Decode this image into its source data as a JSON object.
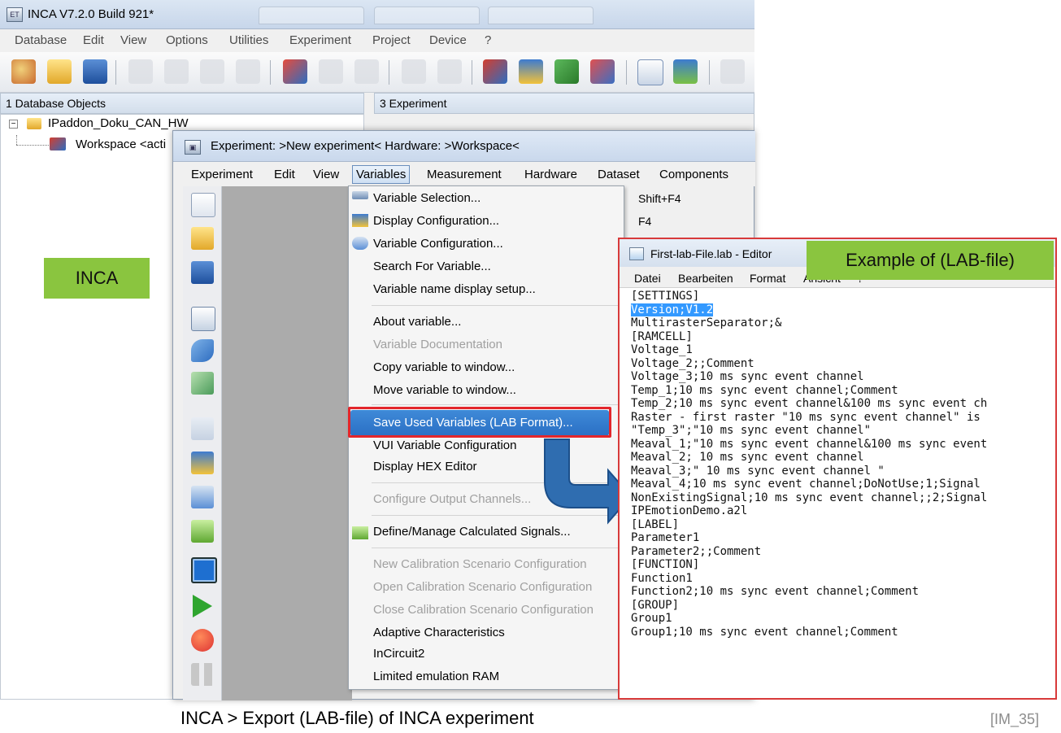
{
  "main_window": {
    "title": "INCA V7.2.0 Build 921*",
    "menu": [
      "Database",
      "Edit",
      "View",
      "Options",
      "Utilities",
      "Experiment",
      "Project",
      "Device",
      "?"
    ],
    "db_pane_title": "1 Database Objects",
    "exp_pane_title": "3 Experiment",
    "tree": {
      "root": "IPaddon_Doku_CAN_HW",
      "child": "Workspace <acti"
    }
  },
  "inca_label": "INCA",
  "experiment_window": {
    "title": "Experiment: >New experiment< Hardware: >Workspace<",
    "menu": [
      "Experiment",
      "Edit",
      "View",
      "Variables",
      "Measurement",
      "Hardware",
      "Dataset",
      "Components"
    ],
    "active_menu": "Variables"
  },
  "variables_menu": {
    "items": [
      {
        "label": "Variable Selection...",
        "shortcut": "Shift+F4",
        "enabled": true,
        "icon": "variable-selection-icon"
      },
      {
        "label": "Display Configuration...",
        "shortcut": "F4",
        "enabled": true,
        "icon": "display-config-icon"
      },
      {
        "label": "Variable Configuration...",
        "shortcut": "",
        "enabled": true,
        "icon": "variable-config-icon"
      },
      {
        "label": "Search For Variable...",
        "shortcut": "",
        "enabled": true,
        "icon": ""
      },
      {
        "label": "Variable name display setup...",
        "shortcut": "",
        "enabled": true,
        "icon": ""
      },
      {
        "label": "About variable...",
        "shortcut": "",
        "enabled": true,
        "icon": ""
      },
      {
        "label": "Variable Documentation",
        "shortcut": "",
        "enabled": false,
        "icon": ""
      },
      {
        "label": "Copy variable to window...",
        "shortcut": "",
        "enabled": true,
        "icon": ""
      },
      {
        "label": "Move variable to window...",
        "shortcut": "",
        "enabled": true,
        "icon": ""
      },
      {
        "label": "Save Used Variables (LAB Format)...",
        "shortcut": "",
        "enabled": true,
        "icon": "",
        "highlighted": true
      },
      {
        "label": "VUI Variable Configuration",
        "shortcut": "",
        "enabled": true,
        "icon": ""
      },
      {
        "label": "Display HEX Editor",
        "shortcut": "",
        "enabled": true,
        "icon": ""
      },
      {
        "label": "Configure Output Channels...",
        "shortcut": "",
        "enabled": false,
        "icon": ""
      },
      {
        "label": "Define/Manage Calculated Signals...",
        "shortcut": "",
        "enabled": true,
        "icon": "calculated-signals-icon"
      },
      {
        "label": "New Calibration Scenario Configuration",
        "shortcut": "",
        "enabled": false,
        "icon": ""
      },
      {
        "label": "Open Calibration Scenario Configuration",
        "shortcut": "",
        "enabled": false,
        "icon": ""
      },
      {
        "label": "Close Calibration Scenario Configuration",
        "shortcut": "",
        "enabled": false,
        "icon": ""
      },
      {
        "label": "Adaptive Characteristics",
        "shortcut": "",
        "enabled": true,
        "icon": ""
      },
      {
        "label": "InCircuit2",
        "shortcut": "",
        "enabled": true,
        "icon": ""
      },
      {
        "label": "Limited emulation RAM",
        "shortcut": "",
        "enabled": true,
        "icon": ""
      }
    ]
  },
  "editor": {
    "title": "First-lab-File.lab - Editor",
    "menu": [
      "Datei",
      "Bearbeiten",
      "Format",
      "Ansicht",
      "?"
    ],
    "selected_line": "Version;V1.2",
    "lines": [
      "[SETTINGS]",
      "Version;V1.2",
      "MultirasterSeparator;&",
      "[RAMCELL]",
      "Voltage_1",
      "Voltage_2;;Comment",
      "Voltage_3;10 ms sync event channel",
      "Temp_1;10 ms sync event channel;Comment",
      "Temp_2;10 ms sync event channel&100 ms sync event ch",
      "Raster - first raster \"10 ms sync event channel\" is",
      "\"Temp_3\";\"10 ms sync event channel\"",
      "Meaval_1;\"10 ms sync event channel&100 ms sync event",
      "Meaval_2; 10 ms sync event channel",
      "Meaval_3;\" 10 ms sync event channel \"",
      "Meaval_4;10 ms sync event channel;DoNotUse;1;Signal",
      "NonExistingSignal;10 ms sync event channel;;2;Signal",
      "IPEmotionDemo.a2l",
      "[LABEL]",
      "Parameter1",
      "Parameter2;;Comment",
      "[FUNCTION]",
      "Function1",
      "Function2;10 ms sync event channel;Comment",
      "[GROUP]",
      "Group1",
      "Group1;10 ms sync event channel;Comment"
    ]
  },
  "lab_label": "Example of (LAB-file)",
  "caption": "INCA > Export (LAB-file) of INCA experiment",
  "reference": "[IM_35]",
  "colors": {
    "badge_green": "#8ac53f",
    "highlight_red": "#e3262b",
    "selection_blue": "#2a6fc4",
    "arrow_blue": "#2f6db0"
  }
}
